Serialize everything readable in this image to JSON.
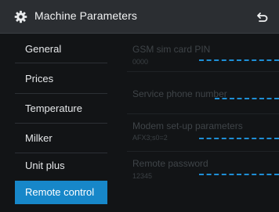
{
  "header": {
    "title": "Machine Parameters"
  },
  "sidebar": {
    "items": [
      {
        "label": "General"
      },
      {
        "label": "Prices"
      },
      {
        "label": "Temperature"
      },
      {
        "label": "Milker"
      },
      {
        "label": "Unit plus"
      },
      {
        "label": "Remote control"
      }
    ],
    "active_index": 5
  },
  "fields": [
    {
      "label": "GSM sim card PIN",
      "value": "0000"
    },
    {
      "label": "Service phone number",
      "value": ""
    },
    {
      "label": "Modem set-up parameters",
      "value": "AFX3;s0=2"
    },
    {
      "label": "Remote password",
      "value": "12345"
    }
  ],
  "colors": {
    "accent": "#1787c9",
    "dashed_line": "#1e8fd6",
    "background": "#121416",
    "titlebar": "#2b2e32"
  },
  "icons": {
    "title": "gear-icon",
    "back": "back-arrow-icon"
  }
}
